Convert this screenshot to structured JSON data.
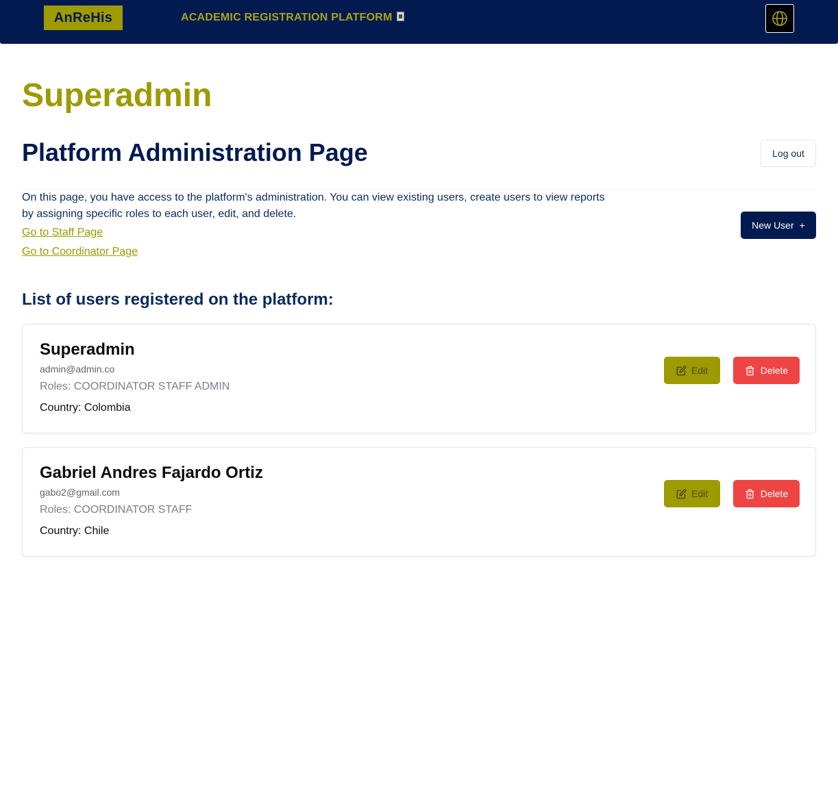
{
  "header": {
    "logo_text": "AnReHis",
    "app_title": "ACADEMIC REGISTRATION PLATFORM",
    "title_icon": "book-icon",
    "language_icon": "globe-icon",
    "bg_color": "#021a4f",
    "accent_color": "#9d9a02"
  },
  "main": {
    "role_title": "Superadmin",
    "page_title": "Platform Administration Page",
    "logout_label": "Log out",
    "description": "On this page, you have access to the platform's administration. You can view existing users, create users to view reports by assigning specific roles to each user, edit, and delete.",
    "links": {
      "staff": "Go to Staff Page",
      "coordinator": "Go to Coordinator Page"
    },
    "new_user_label": "New User",
    "new_user_icon": "+",
    "list_heading": "List of users registered on the platform:"
  },
  "users": [
    {
      "name": "Superadmin",
      "email": "admin@admin.co",
      "roles": "Roles: COORDINATOR STAFF ADMIN",
      "country": "Country: Colombia",
      "edit_label": "Edit",
      "delete_label": "Delete"
    },
    {
      "name": "Gabriel Andres Fajardo Ortiz",
      "email": "gabo2@gmail.com",
      "roles": "Roles: COORDINATOR STAFF",
      "country": "Country: Chile",
      "edit_label": "Edit",
      "delete_label": "Delete"
    }
  ],
  "colors": {
    "edit_button": "#9d9a02",
    "delete_button": "#ef4444",
    "primary_dark": "#021a4f"
  }
}
